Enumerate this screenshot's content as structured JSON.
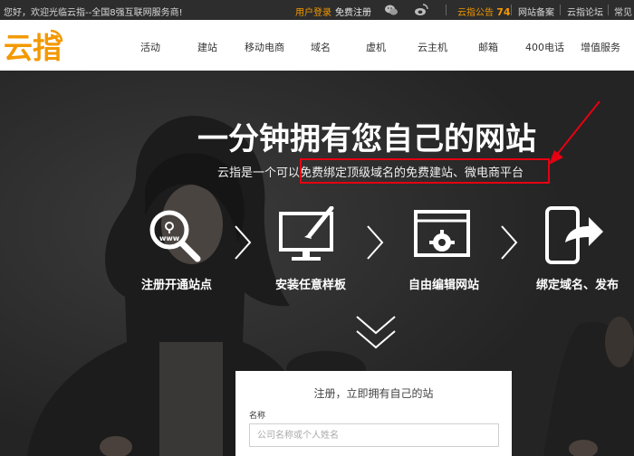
{
  "topbar": {
    "welcome": "您好，欢迎光临云指--全国8强互联网服务商!",
    "login": "用户登录",
    "register": "免费注册",
    "notice_label": "云指公告",
    "notice_count": "74",
    "beian": "网站备案",
    "forum": "云指论坛",
    "faq": "常见"
  },
  "logo": {
    "text": "云指"
  },
  "nav": [
    "活动",
    "建站",
    "移动电商",
    "域名",
    "虚机",
    "云主机",
    "邮箱",
    "400电话",
    "增值服务"
  ],
  "hero": {
    "headline": "一分钟拥有您自己的网站",
    "subline": "云指是一个可以免费绑定顶级域名的免费建站、微电商平台",
    "steps": [
      {
        "label": "注册开通站点",
        "icon": "magnifier-www-icon"
      },
      {
        "label": "安装任意样板",
        "icon": "monitor-brush-icon"
      },
      {
        "label": "自由编辑网站",
        "icon": "browser-gear-icon"
      },
      {
        "label": "绑定域名、发布",
        "icon": "phone-share-icon"
      }
    ]
  },
  "form": {
    "title": "注册，立即拥有自己的站",
    "name_label": "名称",
    "name_placeholder": "公司名称或个人姓名"
  },
  "colors": {
    "accent": "#f39800",
    "highlight": "#e60012"
  }
}
